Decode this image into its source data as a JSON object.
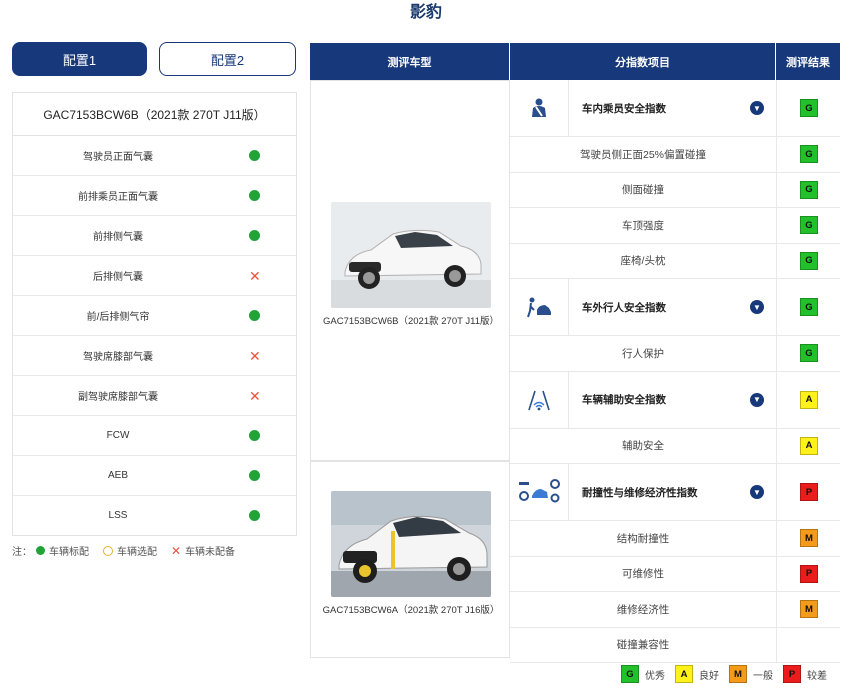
{
  "page_title": "影豹",
  "tabs": [
    {
      "label": "配置1",
      "active": true
    },
    {
      "label": "配置2",
      "active": false
    }
  ],
  "config": {
    "model_name": "GAC7153BCW6B（2021款 270T J11版）",
    "items": [
      {
        "label": "驾驶员正面气囊",
        "status": "standard"
      },
      {
        "label": "前排乘员正面气囊",
        "status": "standard"
      },
      {
        "label": "前排侧气囊",
        "status": "standard"
      },
      {
        "label": "后排侧气囊",
        "status": "none"
      },
      {
        "label": "前/后排侧气帘",
        "status": "standard"
      },
      {
        "label": "驾驶席膝部气囊",
        "status": "none"
      },
      {
        "label": "副驾驶席膝部气囊",
        "status": "none"
      },
      {
        "label": "FCW",
        "status": "standard"
      },
      {
        "label": "AEB",
        "status": "standard"
      },
      {
        "label": "LSS",
        "status": "standard"
      }
    ],
    "legend_prefix": "注：",
    "legend": {
      "standard": "车辆标配",
      "optional": "车辆选配",
      "none": "车辆未配备"
    }
  },
  "table": {
    "headers": [
      "测评车型",
      "分指数项目",
      "测评结果"
    ],
    "vehicles": [
      {
        "caption": "GAC7153BCW6B（2021款 270T J11版）"
      },
      {
        "caption": "GAC7153BCW6A（2021款 270T J16版）"
      }
    ],
    "rows": [
      {
        "type": "main",
        "icon": "occupant-icon",
        "name": "车内乘员安全指数",
        "result": "G"
      },
      {
        "type": "sub",
        "name": "驾驶员侧正面25%偏置碰撞",
        "result": "G"
      },
      {
        "type": "sub",
        "name": "侧面碰撞",
        "result": "G"
      },
      {
        "type": "sub",
        "name": "车顶强度",
        "result": "G"
      },
      {
        "type": "sub",
        "name": "座椅/头枕",
        "result": "G"
      },
      {
        "type": "main",
        "icon": "pedestrian-icon",
        "name": "车外行人安全指数",
        "result": "G"
      },
      {
        "type": "sub",
        "name": "行人保护",
        "result": "G"
      },
      {
        "type": "main",
        "icon": "driver-assist-icon",
        "name": "车辆辅助安全指数",
        "result": "A"
      },
      {
        "type": "sub",
        "name": "辅助安全",
        "result": "A"
      },
      {
        "type": "main",
        "icon": "repair-icon",
        "name": "耐撞性与维修经济性指数",
        "result": "P"
      },
      {
        "type": "sub",
        "name": "结构耐撞性",
        "result": "M"
      },
      {
        "type": "sub",
        "name": "可维修性",
        "result": "P"
      },
      {
        "type": "sub",
        "name": "维修经济性",
        "result": "M"
      },
      {
        "type": "sub",
        "name": "碰撞兼容性",
        "result": ""
      }
    ]
  },
  "rating_legend": [
    {
      "code": "G",
      "label": "优秀",
      "color": "#22c12b"
    },
    {
      "code": "A",
      "label": "良好",
      "color": "#fff11a"
    },
    {
      "code": "M",
      "label": "一般",
      "color": "#f59b1c"
    },
    {
      "code": "P",
      "label": "较差",
      "color": "#ea1c1c"
    }
  ]
}
